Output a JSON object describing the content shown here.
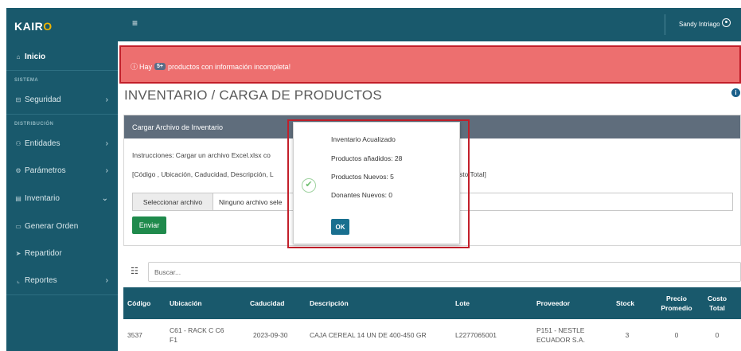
{
  "app": {
    "brand_part1": "KAIR",
    "brand_part2": "O",
    "user_name": "Sandy Intriago"
  },
  "sidebar": {
    "home": "Inicio",
    "section_sistema": "SISTEMA",
    "seguridad": "Seguridad",
    "section_distribucion": "DISTRIBUCIÓN",
    "entidades": "Entidades",
    "parametros": "Parámetros",
    "inventario": "Inventario",
    "generar_orden": "Generar Orden",
    "repartidor": "Repartidor",
    "reportes": "Reportes"
  },
  "alert": {
    "prefix": "Hay",
    "badge": "5+",
    "suffix": "productos con información incompleta!"
  },
  "page": {
    "title": "INVENTARIO / CARGA DE PRODUCTOS"
  },
  "card": {
    "header": "Cargar Archivo de Inventario",
    "instructions_left": "Instrucciones: Cargar un archivo Excel.xlsx co",
    "columns_left": "[Código , Ubicación, Caducidad, Descripción, L",
    "columns_right": "sto Total]",
    "file_button": "Seleccionar archivo",
    "file_value": "Ninguno archivo sele",
    "send_button": "Enviar"
  },
  "modal": {
    "title": "Inventario Acualizado",
    "added": "Productos añadidos: 28",
    "new_products": "Productos Nuevos: 5",
    "new_donors": "Donantes Nuevos: 0",
    "ok_button": "OK"
  },
  "search": {
    "placeholder": "Buscar..."
  },
  "table": {
    "headers": {
      "codigo": "Código",
      "ubicacion": "Ubicación",
      "caducidad": "Caducidad",
      "descripcion": "Descripción",
      "lote": "Lote",
      "proveedor": "Proveedor",
      "stock": "Stock",
      "precio_l1": "Precio",
      "precio_l2": "Promedio",
      "costo_l1": "Costo",
      "costo_l2": "Total"
    },
    "rows": [
      {
        "codigo": "3537",
        "ubicacion_l1": "C61 - RACK C C6",
        "ubicacion_l2": "F1",
        "caducidad": "2023-09-30",
        "descripcion": "CAJA CEREAL 14 UN DE 400-450 GR",
        "lote": "L2277065001",
        "proveedor_l1": "P151 - NESTLE",
        "proveedor_l2": "ECUADOR S.A.",
        "stock": "3",
        "precio": "0",
        "costo": "0"
      }
    ]
  }
}
